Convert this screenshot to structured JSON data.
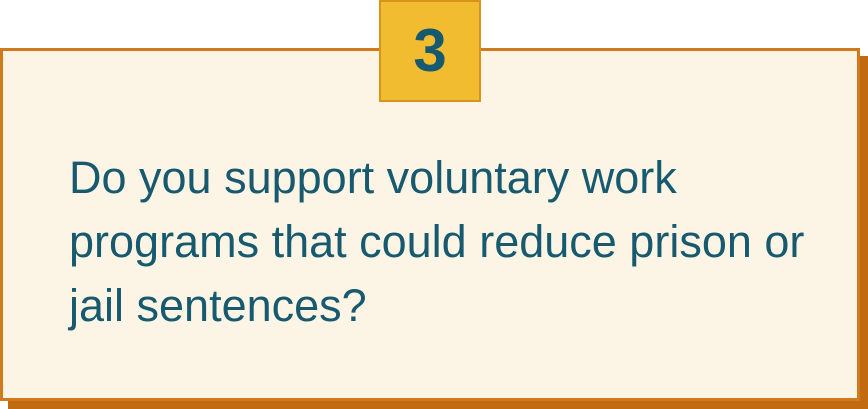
{
  "badge": {
    "number": "3"
  },
  "question": {
    "text": "Do you support voluntary work programs that could reduce prison or jail sentences?"
  },
  "colors": {
    "card_background": "#fcf5e5",
    "card_border": "#d07a1c",
    "card_shadow": "#c26a12",
    "badge_background": "#f2bc30",
    "text": "#175a6f"
  }
}
